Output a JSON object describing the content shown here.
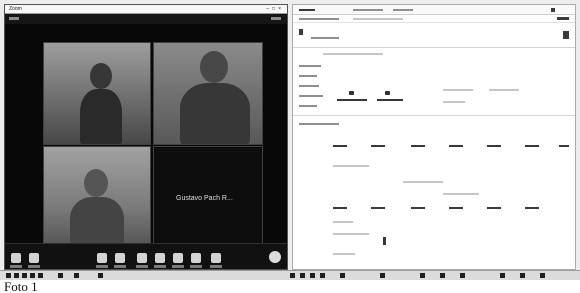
{
  "video_call": {
    "window_title": "Zoom",
    "participants": [
      {
        "tile": "top-left"
      },
      {
        "tile": "top-right"
      },
      {
        "tile": "bottom-left"
      },
      {
        "name": "Gustavo Pach R..."
      }
    ]
  },
  "caption": "Foto 1"
}
